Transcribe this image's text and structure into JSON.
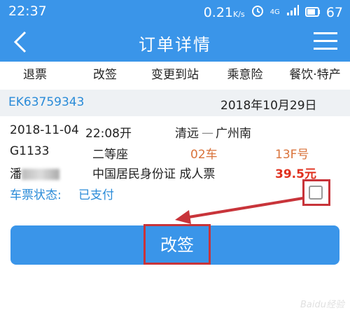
{
  "status_bar": {
    "time": "22:37",
    "speed": "0.21",
    "speed_unit": "K/s",
    "signal": "4G",
    "battery": "67"
  },
  "app_bar": {
    "title": "订单详情"
  },
  "tabs": [
    "退票",
    "改签",
    "变更到站",
    "乘意险",
    "餐饮·特产"
  ],
  "order": {
    "code": "EK63759343",
    "date": "2018年10月29日"
  },
  "ticket": {
    "datetime": "2018-11-04",
    "depart_time": "22:08开",
    "from": "清远",
    "to": "广州南",
    "train": "G1133",
    "seat_class": "二等座",
    "car": "02车",
    "seat": "13F号",
    "passenger_partial": "潘",
    "id_type": "中国居民身份证 成人票",
    "price": "39.5元",
    "status_label": "车票状态:",
    "status_value": "已支付"
  },
  "actions": {
    "change_button": "改签"
  },
  "colors": {
    "accent": "#3a95e9",
    "highlight": "#c8343a",
    "price": "#e0301e",
    "car_seat": "#d9733b",
    "link": "#2a8bd8"
  }
}
